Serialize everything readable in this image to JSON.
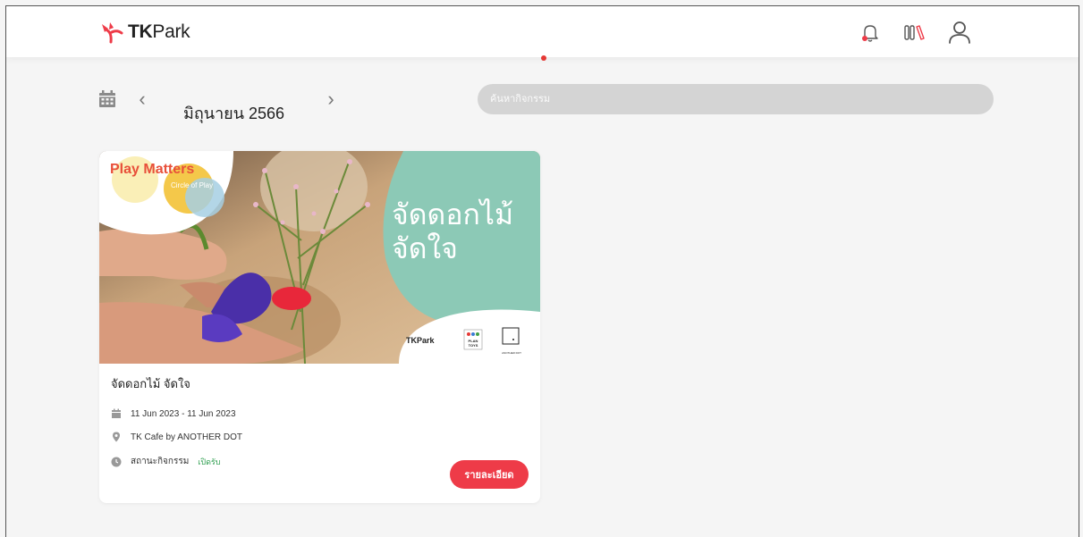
{
  "header": {
    "logo_text_bold": "TK",
    "logo_text_regular": "Park",
    "icons": [
      "bell-icon",
      "library-books-icon",
      "user-icon"
    ]
  },
  "toolbar": {
    "month": "มิถุนายน 2566",
    "prev_label": "‹",
    "next_label": "›",
    "search_placeholder": "ค้นหากิจกรรม"
  },
  "activities": [
    {
      "banner_title_line1": "จัดดอกไม้",
      "banner_title_line2": "จัดใจ",
      "banner_brand_top_line1": "Play Matters",
      "banner_brand_top_line2": "Circle of Play",
      "banner_partner": "TKPark",
      "banner_partner2": "PLAN TOYS",
      "banner_partner3": "ANOTHER DOT",
      "title": "จัดดอกไม้ จัดใจ",
      "date_range": "11 Jun 2023 - 11 Jun 2023",
      "location": "TK Cafe by ANOTHER DOT",
      "status_label": "สถานะกิจกรรม",
      "status_value": "เปิดรับ",
      "detail_button": "รายละเอียด"
    }
  ],
  "colors": {
    "accent": "#ee3b48",
    "status_open": "#2e9e4f",
    "banner_teal": "#8cc9b6"
  }
}
